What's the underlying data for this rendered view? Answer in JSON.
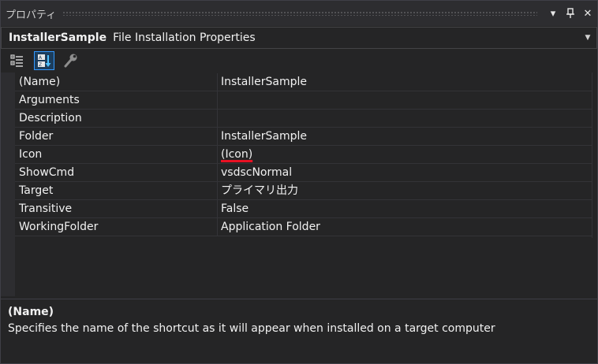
{
  "window": {
    "title": "プロパティ"
  },
  "title_buttons": {
    "dropdown_icon": "▾",
    "pin_icon": "⊥",
    "close_icon": "✕"
  },
  "object_selector": {
    "name": "InstallerSample",
    "type": "File Installation Properties"
  },
  "toolbar": {
    "items": [
      {
        "name": "categorized-icon",
        "active": false
      },
      {
        "name": "alphabetical-icon",
        "active": true
      },
      {
        "name": "property-pages-icon",
        "active": false
      }
    ]
  },
  "properties": [
    {
      "name": "(Name)",
      "value": "InstallerSample"
    },
    {
      "name": "Arguments",
      "value": ""
    },
    {
      "name": "Description",
      "value": ""
    },
    {
      "name": "Folder",
      "value": "InstallerSample"
    },
    {
      "name": "Icon",
      "value": "(Icon)"
    },
    {
      "name": "ShowCmd",
      "value": "vsdscNormal"
    },
    {
      "name": "Target",
      "value": "プライマリ出力"
    },
    {
      "name": "Transitive",
      "value": "False"
    },
    {
      "name": "WorkingFolder",
      "value": "Application Folder"
    }
  ],
  "description": {
    "title": "(Name)",
    "text": "Specifies the name of the shortcut as it will appear when installed on a target computer"
  },
  "colors": {
    "background": "#252526",
    "accent": "#3399ff",
    "highlight_underline": "#e81123"
  }
}
